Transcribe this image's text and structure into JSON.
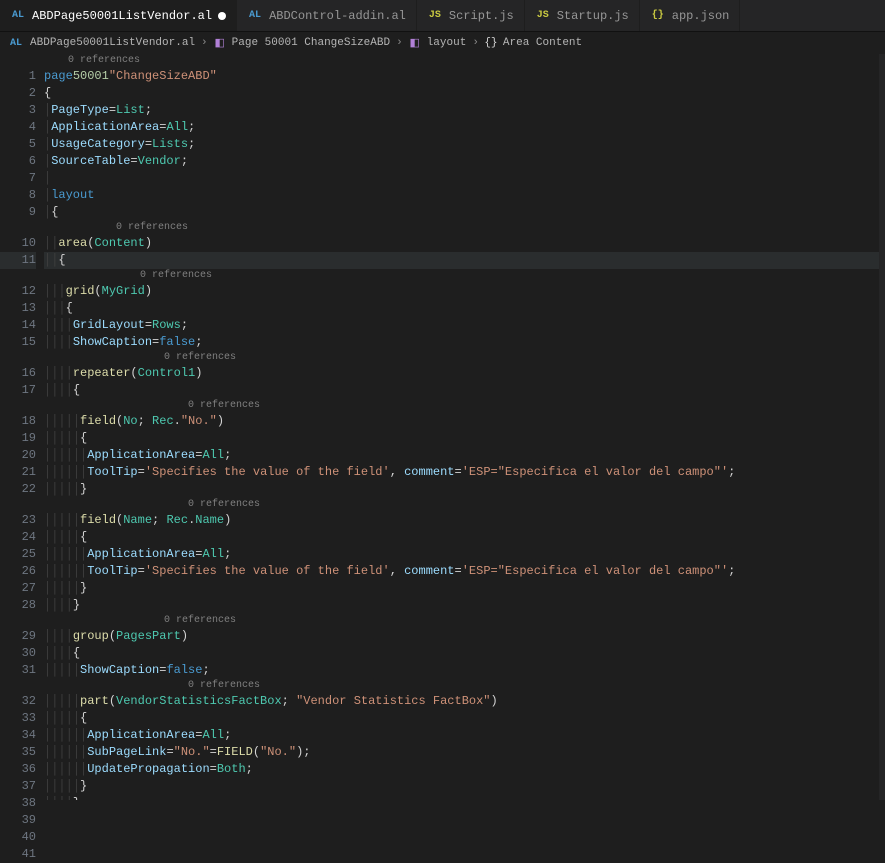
{
  "tabs": [
    {
      "lang": "AL",
      "label": "ABDPage50001ListVendor.al",
      "active": true,
      "dirty": true
    },
    {
      "lang": "AL",
      "label": "ABDControl-addin.al",
      "active": false,
      "dirty": false
    },
    {
      "lang": "JS",
      "label": "Script.js",
      "active": false,
      "dirty": false
    },
    {
      "lang": "JS",
      "label": "Startup.js",
      "active": false,
      "dirty": false
    },
    {
      "lang": "{}",
      "label": "app.json",
      "active": false,
      "dirty": false
    }
  ],
  "breadcrumb": {
    "file_lang": "AL",
    "file": "ABDPage50001ListVendor.al",
    "parts": [
      "Page 50001 ChangeSizeABD",
      "layout",
      "Area Content"
    ]
  },
  "refs_label": "0 references",
  "code": {
    "page_kw": "page",
    "page_num": "50001",
    "page_name": "\"ChangeSizeABD\"",
    "pagetype": {
      "k": "PageType",
      "v": "List"
    },
    "apparea": {
      "k": "ApplicationArea",
      "v": "All"
    },
    "usage": {
      "k": "UsageCategory",
      "v": "Lists"
    },
    "srctbl": {
      "k": "SourceTable",
      "v": "Vendor"
    },
    "layout_kw": "layout",
    "area_fn": "area",
    "area_arg": "Content",
    "grid_fn": "grid",
    "grid_arg": "MyGrid",
    "gridlayout": {
      "k": "GridLayout",
      "v": "Rows"
    },
    "showcap": {
      "k": "ShowCaption",
      "v": "false"
    },
    "repeater_fn": "repeater",
    "repeater_arg": "Control1",
    "field_fn": "field",
    "field1_a": "No",
    "field1_b1": "Rec",
    "field1_b2": "\"No.\"",
    "apparea2": {
      "k": "ApplicationArea",
      "v": "All"
    },
    "tooltip_k": "ToolTip",
    "tooltip_v": "'Specifies the value of the field'",
    "comment_k": "comment",
    "comment_v": "'ESP=\"Especifica el valor del campo\"'",
    "field2_a": "Name",
    "field2_b1": "Rec",
    "field2_b2": "Name",
    "group_fn": "group",
    "group_arg": "PagesPart",
    "showcap2": {
      "k": "ShowCaption",
      "v": "false"
    },
    "part_fn": "part",
    "part_a": "VendorStatisticsFactBox",
    "part_b": "\"Vendor Statistics FactBox\"",
    "apparea3": {
      "k": "ApplicationArea",
      "v": "All"
    },
    "subpage_k": "SubPageLink",
    "subpage_f": "\"No.\"",
    "subpage_fn": "FIELD",
    "subpage_arg": "\"No.\"",
    "update_k": "UpdatePropagation",
    "update_v": "Both"
  },
  "line_numbers": [
    "1",
    "2",
    "3",
    "4",
    "5",
    "6",
    "7",
    "8",
    "9",
    "10",
    "11",
    "12",
    "13",
    "14",
    "15",
    "16",
    "17",
    "18",
    "19",
    "20",
    "21",
    "22",
    "23",
    "24",
    "25",
    "26",
    "27",
    "28",
    "29",
    "30",
    "31",
    "32",
    "33",
    "34",
    "35",
    "36",
    "37",
    "38",
    "39",
    "40",
    "41"
  ]
}
